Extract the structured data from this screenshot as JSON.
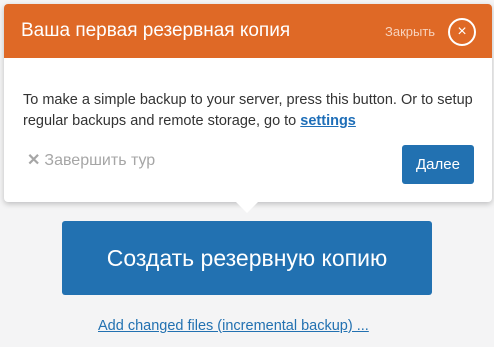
{
  "tour": {
    "title": "Ваша первая резервная копия",
    "close_label": "Закрыть",
    "close_icon": "×",
    "body_text": "To make a simple backup to your server, press this button. Or to setup regular backups and remote storage, go to ",
    "settings_link": "settings",
    "end_tour_icon": "✕",
    "end_tour_label": "Завершить тур",
    "next_label": "Далее"
  },
  "main": {
    "backup_button_label": "Создать резервную копию",
    "incremental_link": "Add changed files (incremental backup) ..."
  },
  "colors": {
    "header": "#df6926",
    "primary": "#2271b1",
    "muted": "#a6a6a6"
  }
}
